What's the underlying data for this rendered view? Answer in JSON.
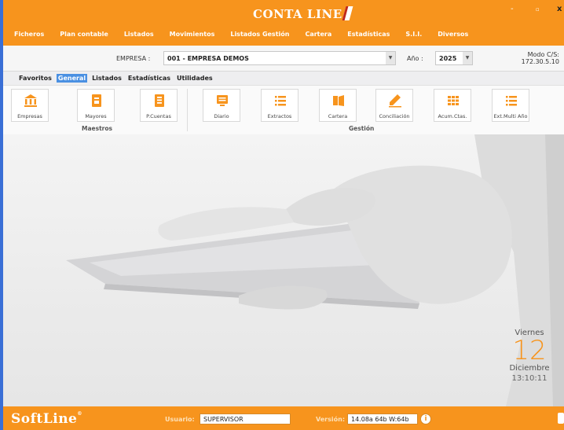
{
  "app": {
    "logo_text": "CONTA LINE",
    "menu": [
      "Ficheros",
      "Plan contable",
      "Listados",
      "Movimientos",
      "Listados Gestión",
      "Cartera",
      "Estadísticas",
      "S.I.I.",
      "Diversos"
    ],
    "window_controls": {
      "minimize": "-",
      "maximize": "▫",
      "close": "x"
    }
  },
  "company_bar": {
    "empresa_label": "EMPRESA :",
    "empresa_value": "001 - EMPRESA DEMOS",
    "anio_label": "Año :",
    "anio_value": "2025",
    "modo_line1": "Modo C/S:",
    "modo_line2": "172.30.5.10"
  },
  "tabs": [
    {
      "label": "Favoritos",
      "active": false
    },
    {
      "label": "General",
      "active": true
    },
    {
      "label": "Listados",
      "active": false
    },
    {
      "label": "Estadísticas",
      "active": false
    },
    {
      "label": "Utilidades",
      "active": false
    }
  ],
  "ribbon": {
    "groups": [
      {
        "label": "Maestros",
        "buttons": [
          "Empresas",
          "Mayores",
          "P.Cuentas"
        ]
      },
      {
        "label": "Gestión",
        "buttons": [
          "Diario",
          "Extractos",
          "Cartera",
          "Conciliación",
          "Acum.Ctas.",
          "Ext.Multi Año"
        ]
      }
    ],
    "icons": [
      "bank-icon",
      "ledger-icon",
      "chart-of-accounts-icon",
      "journal-icon",
      "list-icon",
      "folder-icon",
      "pencil-icon",
      "grid-icon",
      "list-icon"
    ],
    "accent_color": "#f7941d"
  },
  "date_panel": {
    "weekday": "Viernes",
    "day": "12",
    "month": "Diciembre",
    "time": "13:10:11"
  },
  "status_bar": {
    "brand": "SoftLine",
    "usuario_label": "Usuario:",
    "usuario_value": "SUPERVISOR",
    "version_label": "Versión:",
    "version_value": "14.08a 64b W:64b"
  }
}
